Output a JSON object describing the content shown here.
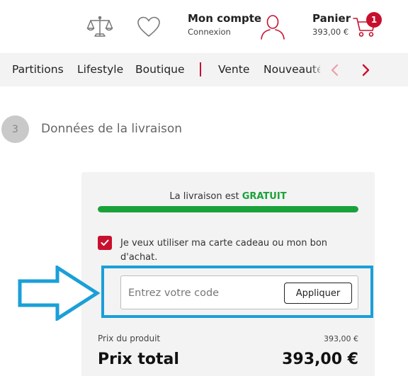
{
  "header": {
    "account": {
      "title": "Mon compte",
      "subtitle": "Connexion"
    },
    "cart": {
      "title": "Panier",
      "amount": "393,00 €",
      "badge_count": "1"
    },
    "icons": [
      "scale-icon",
      "heart-icon",
      "user-icon",
      "cart-icon"
    ]
  },
  "nav": {
    "items": [
      "Partitions",
      "Lifestyle",
      "Boutique",
      "Vente",
      "Nouveautés"
    ],
    "prev_icon": "chevron-left-icon",
    "next_icon": "chevron-right-icon"
  },
  "step": {
    "number": "3",
    "title": "Données de la livraison"
  },
  "delivery": {
    "free_prefix": "La livraison est ",
    "free_highlight": "GRATUIT",
    "progress_percent": 100
  },
  "gift": {
    "checked": true,
    "label": "Je veux utiliser ma carte cadeau ou mon bon d'achat.",
    "placeholder": "Entrez votre code",
    "apply_label": "Appliquer"
  },
  "summary": {
    "product_label": "Prix du produit",
    "product_value": "393,00 €",
    "total_label": "Prix total",
    "total_value": "393,00 €"
  },
  "colors": {
    "brand_red": "#c8102e",
    "success_green": "#1aa23a",
    "annotation_blue": "#1a9fd8",
    "panel_bg": "#f3f3f3"
  }
}
